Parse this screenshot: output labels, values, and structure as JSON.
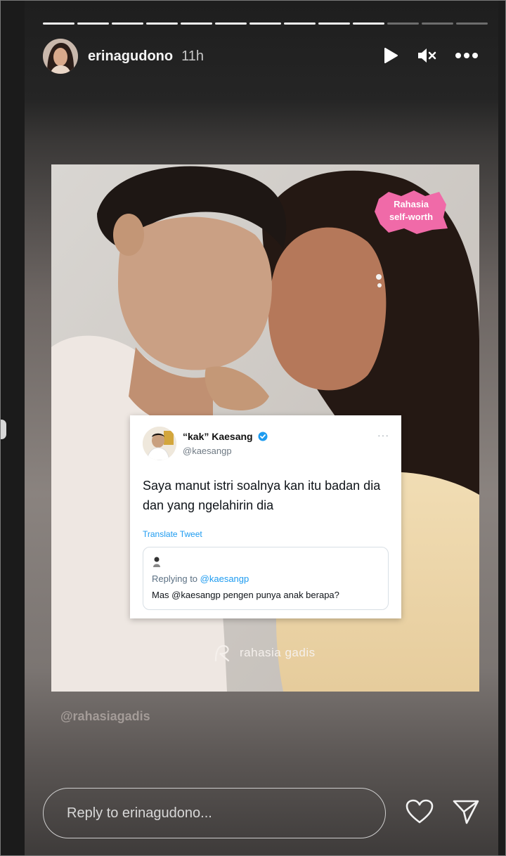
{
  "story": {
    "progress_total": 13,
    "progress_done": 10
  },
  "header": {
    "username": "erinagudono",
    "time": "11h",
    "icons": [
      "play-icon",
      "mute-icon",
      "more-icon"
    ]
  },
  "post": {
    "sticker": {
      "line1": "Rahasia",
      "line2": "self-worth"
    },
    "tweet": {
      "name": "“kak” Kaesang",
      "handle": "@kaesangp",
      "more": "···",
      "body": "Saya manut istri soalnya kan itu badan dia dan yang ngelahirin dia",
      "translate": "Translate Tweet",
      "quote": {
        "replying_prefix": "Replying to ",
        "replying_handle": "@kaesangp",
        "text": "Mas @kaesangp pengen punya anak berapa?"
      }
    },
    "watermark": "rahasia gadis"
  },
  "mention": "@rahasiagadis",
  "reply": {
    "placeholder": "Reply to erinagudono..."
  },
  "colors": {
    "accent_blue": "#1d9bf0",
    "sticker_pink": "#f06aa8"
  }
}
